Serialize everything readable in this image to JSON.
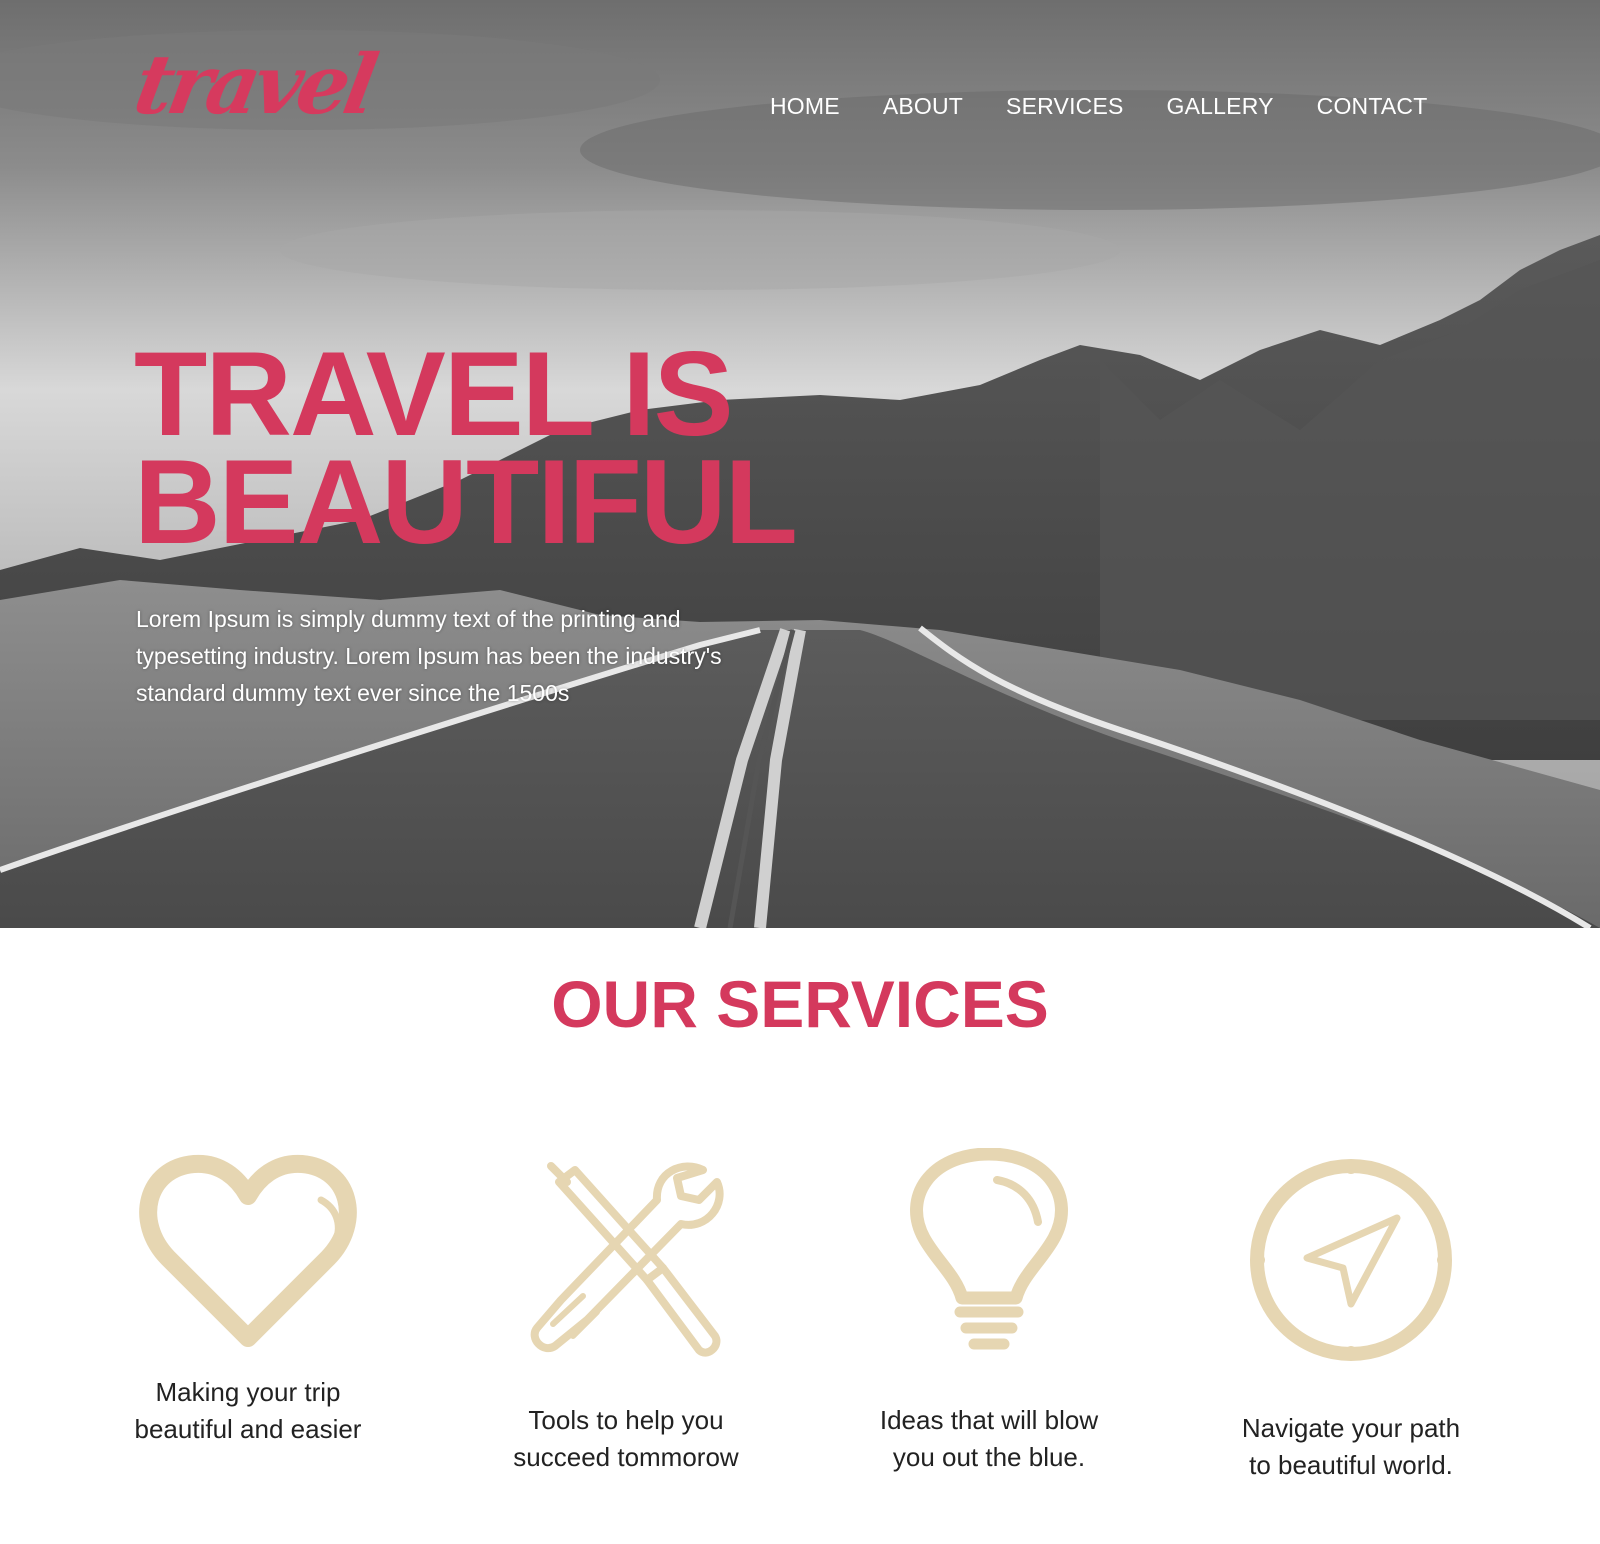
{
  "colors": {
    "accent": "#d4395d",
    "icon": "#e6d6b2",
    "nav_text": "#ffffff",
    "body_text": "#222222"
  },
  "header": {
    "logo_text": "travel",
    "nav": [
      {
        "label": "HOME"
      },
      {
        "label": "ABOUT"
      },
      {
        "label": "SERVICES"
      },
      {
        "label": "GALLERY"
      },
      {
        "label": "CONTACT"
      }
    ]
  },
  "hero": {
    "headline_line1": "TRAVEL IS",
    "headline_line2": "BEAUTIFUL",
    "intro_line1": "Lorem Ipsum is simply dummy text of the printing and",
    "intro_line2": "typesetting industry. Lorem Ipsum has been the industry's",
    "intro_line3": "standard dummy text ever since the 1500s",
    "background": "black-and-white desert road photo"
  },
  "services": {
    "title": "OUR SERVICES",
    "items": [
      {
        "icon": "heart-icon",
        "line1": "Making your trip",
        "line2": "beautiful and easier"
      },
      {
        "icon": "tools-icon",
        "line1": "Tools to help you",
        "line2": "succeed tommorow"
      },
      {
        "icon": "lightbulb-icon",
        "line1": "Ideas that will blow",
        "line2": "you out the blue."
      },
      {
        "icon": "compass-icon",
        "line1": "Navigate your path",
        "line2": "to beautiful world."
      }
    ]
  }
}
